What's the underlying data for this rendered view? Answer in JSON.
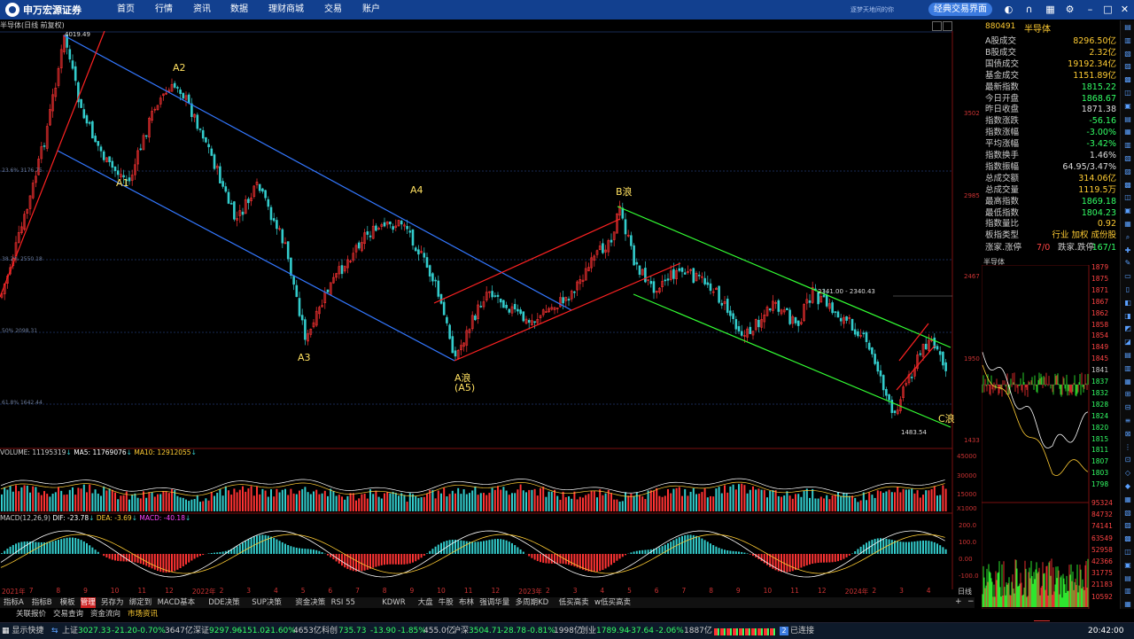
{
  "app": {
    "logo_text": "申万宏源证券",
    "slogan": "逐梦天地间的你",
    "classic_button": "经典交易界面"
  },
  "nav": [
    "首页",
    "行情",
    "资讯",
    "数据",
    "理财商城",
    "交易",
    "账户"
  ],
  "top_icons": [
    "skin-icon",
    "headset-icon",
    "grid-icon",
    "search-icon",
    "settings-icon",
    "minimize-icon",
    "maximize-icon",
    "close-icon"
  ],
  "chart": {
    "title": "半导体(日线 前复权)",
    "high_label": "4019.49",
    "low_label": "1483.54",
    "range_label": "2341.00 - 2340.43",
    "fib": [
      "23.6% 3176.75",
      "38.2% 2550.18",
      "50% 2098.31",
      "61.8% 1642.44"
    ],
    "wave_labels": [
      "A2",
      "A1",
      "A4",
      "A3",
      "A浪",
      "(A5)",
      "B浪",
      "C浪"
    ],
    "price_axis": [
      "3502",
      "2985",
      "2467",
      "1950",
      "1433"
    ],
    "volume_title": "VOLUME: 11195319",
    "volume_ma5": "MA5: 11769076",
    "volume_ma10": "MA10: 12912055",
    "volume_axis": [
      "45000",
      "30000",
      "15000",
      "X1000"
    ],
    "macd_title": "MACD(12,26,9)",
    "macd_dif": "DIF: -23.78",
    "macd_dea": "DEA: -3.69",
    "macd_val": "MACD: -40.18",
    "macd_axis": [
      "200.0",
      "100.0",
      "0.00",
      "-100.0"
    ],
    "date_axis": [
      "2021年",
      "7",
      "8",
      "9",
      "10",
      "11",
      "12",
      "2022年",
      "2",
      "3",
      "4",
      "5",
      "6",
      "7",
      "8",
      "9",
      "10",
      "11",
      "12",
      "2023年",
      "2",
      "3",
      "4",
      "5",
      "6",
      "7",
      "8",
      "9",
      "10",
      "11",
      "12",
      "2024年",
      "2",
      "3",
      "4"
    ],
    "period_label": "日线",
    "colors": {
      "up": "#ff3333",
      "down": "#33cccc",
      "blue_channel": "#3377ff",
      "green_channel": "#33ff33",
      "red_line": "#ff2222",
      "label": "#ffe060"
    }
  },
  "quote": {
    "code": "880491",
    "name": "半导体",
    "rows": [
      {
        "k": "A股成交",
        "v": "8296.50亿",
        "c": "#ffcc33"
      },
      {
        "k": "B股成交",
        "v": "2.32亿",
        "c": "#ffcc33"
      },
      {
        "k": "国债成交",
        "v": "19192.34亿",
        "c": "#ffcc33"
      },
      {
        "k": "基金成交",
        "v": "1151.89亿",
        "c": "#ffcc33"
      },
      {
        "k": "最新指数",
        "v": "1815.22",
        "c": "#33ff66"
      },
      {
        "k": "今日开盘",
        "v": "1868.67",
        "c": "#33ff66"
      },
      {
        "k": "昨日收盘",
        "v": "1871.38",
        "c": "#dddddd"
      },
      {
        "k": "指数涨跌",
        "v": "-56.16",
        "c": "#33ff66"
      },
      {
        "k": "指数涨幅",
        "v": "-3.00%",
        "c": "#33ff66"
      },
      {
        "k": "平均涨幅",
        "v": "-3.42%",
        "c": "#33ff66"
      },
      {
        "k": "指数换手",
        "v": "1.46%",
        "c": "#dddddd"
      },
      {
        "k": "指数振幅",
        "v": "64.95/3.47%",
        "c": "#dddddd"
      },
      {
        "k": "总成交额",
        "v": "314.06亿",
        "c": "#ffcc33"
      },
      {
        "k": "总成交量",
        "v": "1119.5万",
        "c": "#ffcc33"
      },
      {
        "k": "最高指数",
        "v": "1869.18",
        "c": "#33ff66"
      },
      {
        "k": "最低指数",
        "v": "1804.23",
        "c": "#33ff66"
      },
      {
        "k": "指数量比",
        "v": "0.92",
        "c": "#ffcc33"
      },
      {
        "k": "板指类型",
        "v": "行业 加权 成份股",
        "c": "#ffcc33"
      }
    ],
    "updown": {
      "up_label": "涨家.涨停",
      "up_value": "7/0",
      "down_label": "跌家.跌停",
      "down_value": "167/1"
    },
    "mini_title": "半导体",
    "mini_axis": [
      "1879",
      "1875",
      "1871",
      "1867",
      "1862",
      "1858",
      "1854",
      "1849",
      "1845",
      "1841",
      "1837",
      "1832",
      "1828",
      "1824",
      "1820",
      "1815",
      "1811",
      "1807",
      "1803",
      "1798"
    ],
    "mini_vol_axis": [
      "95324",
      "84732",
      "74141",
      "63549",
      "52958",
      "42366",
      "31775",
      "21183",
      "10592"
    ]
  },
  "tabs": [
    "指标A",
    "指标B",
    "模板",
    "管理",
    "另存为",
    "绑定到",
    "MACD基本",
    "DDE决策",
    "SUP决策",
    "资金决策",
    "RSI 55",
    "KDWR",
    "大盘",
    "牛股",
    "布林",
    "强调华量",
    "多周期KD",
    "低买高卖",
    "w低买高卖"
  ],
  "tabs_row2": [
    "关联报价",
    "交易查询",
    "资金流向",
    "市场资讯"
  ],
  "right_tabs": [
    "笔",
    "价",
    "细",
    "势",
    "联",
    "值",
    "主",
    "筹"
  ],
  "status": {
    "quick": "显示快捷",
    "sh_label": "上证",
    "sh_val": "3027.33",
    "sh_chg": "-21.20",
    "sh_pct": "-0.70%",
    "sh_amt": "3647亿",
    "sz_label": "深证",
    "sz_val": "9297.96",
    "sz_chg": "-151.02",
    "sz_pct": "-1.60%",
    "sz_amt": "4653亿",
    "kc_label": "科创",
    "kc_val": "735.73",
    "kc_chg": "-13.90",
    "kc_pct": "-1.85%",
    "kc_amt": "455.0亿",
    "hs_label": "沪深",
    "hs_val": "3504.71",
    "hs_chg": "-28.78",
    "hs_pct": "-0.81%",
    "hs_amt": "1998亿",
    "cy_label": "创业",
    "cy_val": "1789.94",
    "cy_chg": "-37.64",
    "cy_pct": "-2.06%",
    "cy_amt": "1887亿",
    "conn": "已连接",
    "time": "20:42:00"
  }
}
